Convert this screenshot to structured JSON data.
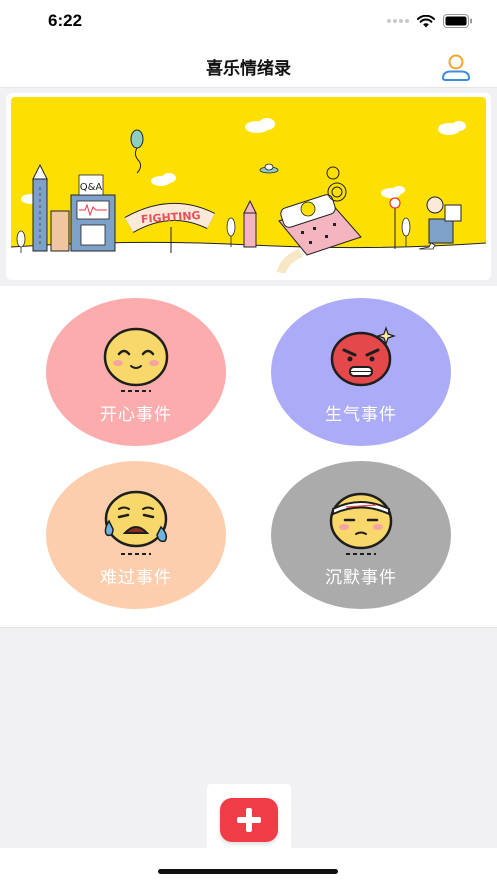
{
  "status": {
    "time": "6:22"
  },
  "header": {
    "title": "喜乐情绪录"
  },
  "banner": {
    "sign_text": "FIGHTING",
    "qa_text": "Q&A"
  },
  "moods": [
    {
      "label": "开心事件",
      "color": "#fcacac",
      "icon": "happy-face-icon"
    },
    {
      "label": "生气事件",
      "color": "#acabf8",
      "icon": "angry-face-icon"
    },
    {
      "label": "难过事件",
      "color": "#fcceae",
      "icon": "crying-face-icon"
    },
    {
      "label": "沉默事件",
      "color": "#ababab",
      "icon": "silent-face-icon"
    }
  ],
  "tabbar": {
    "add_icon": "plus-icon",
    "accent": "#ef3c47"
  }
}
